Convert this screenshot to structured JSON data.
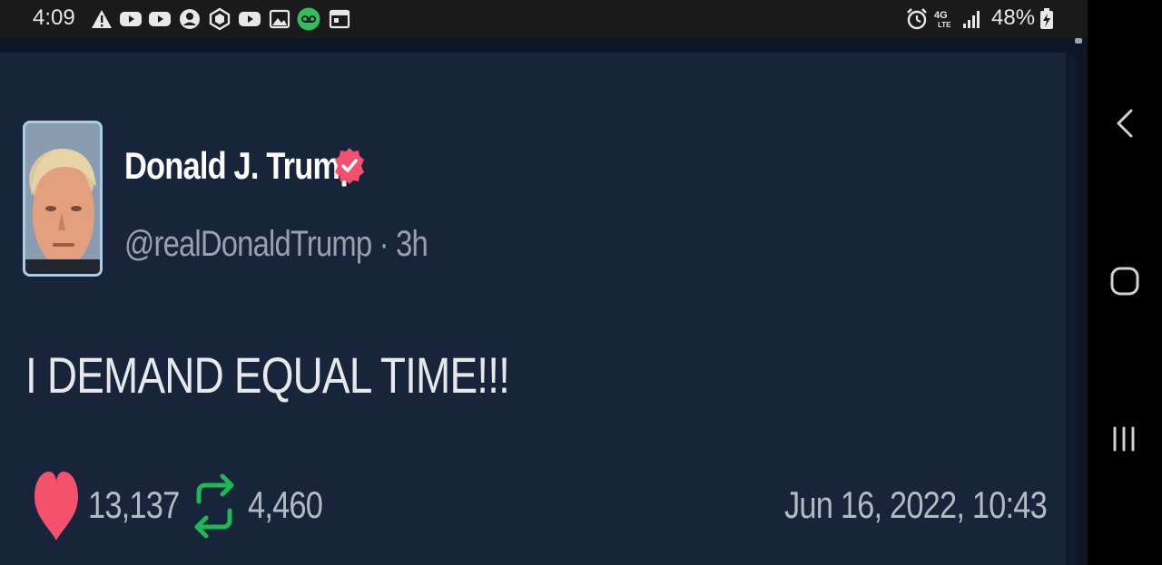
{
  "status_bar": {
    "time": "4:09",
    "left_icons": [
      "warning-icon",
      "youtube-icon",
      "youtube-icon",
      "account-circle-icon",
      "crypto-icon",
      "youtube-icon",
      "gallery-icon",
      "voicemail-icon",
      "calendar-icon"
    ],
    "right_icons": [
      "alarm-icon",
      "lte-icon",
      "signal-icon",
      "battery-charging-icon"
    ],
    "network_label": "4G LTE",
    "battery_percent": "48%"
  },
  "tweet": {
    "display_name": "Donald J. Trump",
    "verified": true,
    "handle": "@realDonaldTrump",
    "separator": "·",
    "age": "3h",
    "text": "I DEMAND EQUAL TIME!!!",
    "likes": "13,137",
    "retweets": "4,460",
    "timestamp": "Jun 16, 2022, 10:43"
  },
  "nav_bar": {
    "buttons": [
      "back-icon",
      "home-icon",
      "recents-icon"
    ]
  },
  "colors": {
    "card_background": "#17243a",
    "verified_badge": "#f4516c",
    "like_heart": "#f4516c",
    "retweet_green": "#1db954",
    "name_text": "#ffffff",
    "secondary_text": "#98a2ad"
  }
}
